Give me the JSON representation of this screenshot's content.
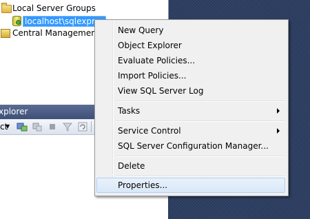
{
  "tree": {
    "items": [
      {
        "label": "Local Server Groups"
      },
      {
        "label": "localhost\\sqlexpres"
      },
      {
        "label": "Central Management S"
      }
    ]
  },
  "object_explorer": {
    "title": "xplorer",
    "connect_label": "ct"
  },
  "context_menu": {
    "items": [
      {
        "label": "New Query"
      },
      {
        "label": "Object Explorer"
      },
      {
        "label": "Evaluate Policies..."
      },
      {
        "label": "Import Policies..."
      },
      {
        "label": "View SQL Server Log"
      },
      {
        "label": "Tasks"
      },
      {
        "label": "Service Control"
      },
      {
        "label": "SQL Server Configuration Manager..."
      },
      {
        "label": "Delete"
      },
      {
        "label": "Properties..."
      }
    ]
  }
}
